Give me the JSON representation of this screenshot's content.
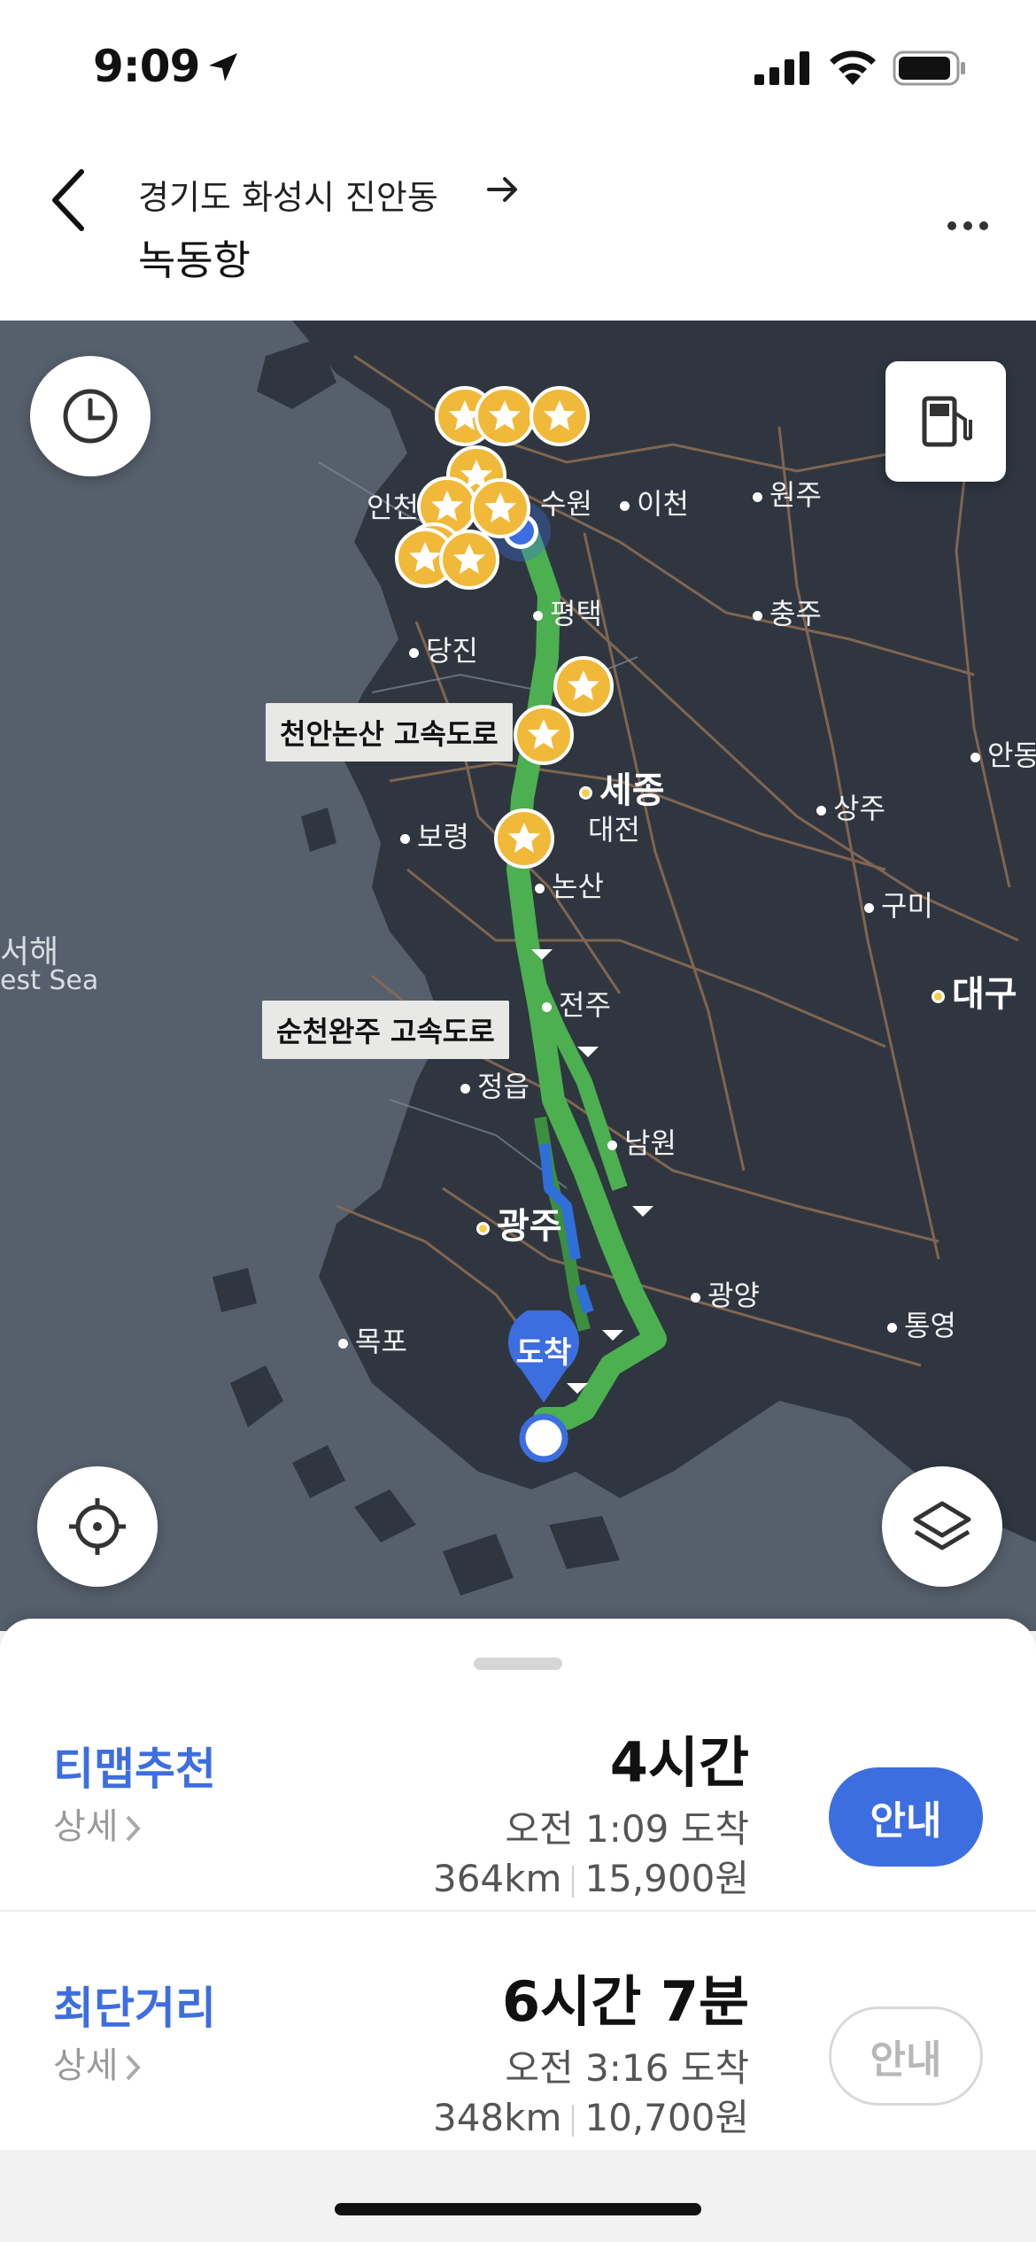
{
  "status_bar": {
    "time": "9:09"
  },
  "header": {
    "origin": "경기도 화성시 진안동",
    "destination": "녹동항"
  },
  "map": {
    "cities": {
      "incheon": "인천",
      "suwon": "수원",
      "icheon": "이천",
      "wonju": "원주",
      "pyeongtaek": "평택",
      "chungju": "충주",
      "dangjin": "당진",
      "sejong": "세종",
      "daejeon": "대전",
      "andong": "안동",
      "sangju": "상주",
      "boryeong": "보령",
      "nonsan": "논산",
      "gumi": "구미",
      "daegu": "대구",
      "jeonju": "전주",
      "jeongeup": "정읍",
      "namwon": "남원",
      "gwangju": "광주",
      "gwangyang": "광양",
      "tongyeong": "통영",
      "mokpo": "목포",
      "west_sea_ko": "서해",
      "west_sea_en": "est Sea"
    },
    "road_labels": {
      "cheonan_nonsan": "천안논산 고속도로",
      "suncheon_wanju": "순천완주 고속도로"
    },
    "destination_marker": "도착",
    "colors": {
      "route": "#4caf50",
      "highlight": "#2f6fd8",
      "water": "#56606c",
      "land": "#2f3640"
    },
    "icons": [
      "clock-icon",
      "gas-station-icon",
      "locate-icon",
      "layers-icon",
      "star-icon"
    ]
  },
  "routes": [
    {
      "name": "티맵추천",
      "detail": "상세",
      "duration": "4시간",
      "arrival": "오전 1:09 도착",
      "distance": "364km",
      "toll": "15,900원",
      "button": "안내"
    },
    {
      "name": "최단거리",
      "detail": "상세",
      "duration": "6시간 7분",
      "arrival": "오전 3:16 도착",
      "distance": "348km",
      "toll": "10,700원",
      "button": "안내"
    }
  ]
}
